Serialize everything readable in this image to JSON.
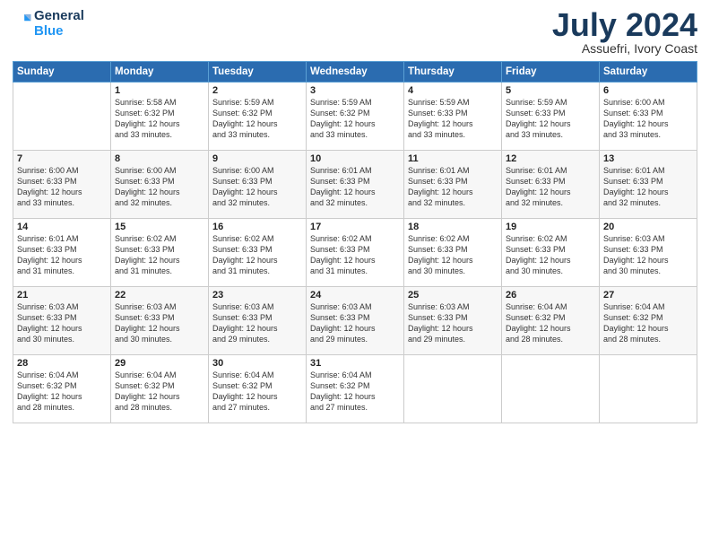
{
  "header": {
    "logo_line1": "General",
    "logo_line2": "Blue",
    "month_title": "July 2024",
    "subtitle": "Assuefri, Ivory Coast"
  },
  "days_of_week": [
    "Sunday",
    "Monday",
    "Tuesday",
    "Wednesday",
    "Thursday",
    "Friday",
    "Saturday"
  ],
  "weeks": [
    [
      {
        "day": "",
        "info": ""
      },
      {
        "day": "1",
        "info": "Sunrise: 5:58 AM\nSunset: 6:32 PM\nDaylight: 12 hours\nand 33 minutes."
      },
      {
        "day": "2",
        "info": "Sunrise: 5:59 AM\nSunset: 6:32 PM\nDaylight: 12 hours\nand 33 minutes."
      },
      {
        "day": "3",
        "info": "Sunrise: 5:59 AM\nSunset: 6:32 PM\nDaylight: 12 hours\nand 33 minutes."
      },
      {
        "day": "4",
        "info": "Sunrise: 5:59 AM\nSunset: 6:33 PM\nDaylight: 12 hours\nand 33 minutes."
      },
      {
        "day": "5",
        "info": "Sunrise: 5:59 AM\nSunset: 6:33 PM\nDaylight: 12 hours\nand 33 minutes."
      },
      {
        "day": "6",
        "info": "Sunrise: 6:00 AM\nSunset: 6:33 PM\nDaylight: 12 hours\nand 33 minutes."
      }
    ],
    [
      {
        "day": "7",
        "info": ""
      },
      {
        "day": "8",
        "info": "Sunrise: 6:00 AM\nSunset: 6:33 PM\nDaylight: 12 hours\nand 32 minutes."
      },
      {
        "day": "9",
        "info": "Sunrise: 6:00 AM\nSunset: 6:33 PM\nDaylight: 12 hours\nand 32 minutes."
      },
      {
        "day": "10",
        "info": "Sunrise: 6:01 AM\nSunset: 6:33 PM\nDaylight: 12 hours\nand 32 minutes."
      },
      {
        "day": "11",
        "info": "Sunrise: 6:01 AM\nSunset: 6:33 PM\nDaylight: 12 hours\nand 32 minutes."
      },
      {
        "day": "12",
        "info": "Sunrise: 6:01 AM\nSunset: 6:33 PM\nDaylight: 12 hours\nand 32 minutes."
      },
      {
        "day": "13",
        "info": "Sunrise: 6:01 AM\nSunset: 6:33 PM\nDaylight: 12 hours\nand 32 minutes."
      }
    ],
    [
      {
        "day": "14",
        "info": ""
      },
      {
        "day": "15",
        "info": "Sunrise: 6:02 AM\nSunset: 6:33 PM\nDaylight: 12 hours\nand 31 minutes."
      },
      {
        "day": "16",
        "info": "Sunrise: 6:02 AM\nSunset: 6:33 PM\nDaylight: 12 hours\nand 31 minutes."
      },
      {
        "day": "17",
        "info": "Sunrise: 6:02 AM\nSunset: 6:33 PM\nDaylight: 12 hours\nand 31 minutes."
      },
      {
        "day": "18",
        "info": "Sunrise: 6:02 AM\nSunset: 6:33 PM\nDaylight: 12 hours\nand 30 minutes."
      },
      {
        "day": "19",
        "info": "Sunrise: 6:02 AM\nSunset: 6:33 PM\nDaylight: 12 hours\nand 30 minutes."
      },
      {
        "day": "20",
        "info": "Sunrise: 6:03 AM\nSunset: 6:33 PM\nDaylight: 12 hours\nand 30 minutes."
      }
    ],
    [
      {
        "day": "21",
        "info": ""
      },
      {
        "day": "22",
        "info": "Sunrise: 6:03 AM\nSunset: 6:33 PM\nDaylight: 12 hours\nand 30 minutes."
      },
      {
        "day": "23",
        "info": "Sunrise: 6:03 AM\nSunset: 6:33 PM\nDaylight: 12 hours\nand 29 minutes."
      },
      {
        "day": "24",
        "info": "Sunrise: 6:03 AM\nSunset: 6:33 PM\nDaylight: 12 hours\nand 29 minutes."
      },
      {
        "day": "25",
        "info": "Sunrise: 6:03 AM\nSunset: 6:33 PM\nDaylight: 12 hours\nand 29 minutes."
      },
      {
        "day": "26",
        "info": "Sunrise: 6:04 AM\nSunset: 6:32 PM\nDaylight: 12 hours\nand 28 minutes."
      },
      {
        "day": "27",
        "info": "Sunrise: 6:04 AM\nSunset: 6:32 PM\nDaylight: 12 hours\nand 28 minutes."
      }
    ],
    [
      {
        "day": "28",
        "info": "Sunrise: 6:04 AM\nSunset: 6:32 PM\nDaylight: 12 hours\nand 28 minutes."
      },
      {
        "day": "29",
        "info": "Sunrise: 6:04 AM\nSunset: 6:32 PM\nDaylight: 12 hours\nand 28 minutes."
      },
      {
        "day": "30",
        "info": "Sunrise: 6:04 AM\nSunset: 6:32 PM\nDaylight: 12 hours\nand 27 minutes."
      },
      {
        "day": "31",
        "info": "Sunrise: 6:04 AM\nSunset: 6:32 PM\nDaylight: 12 hours\nand 27 minutes."
      },
      {
        "day": "",
        "info": ""
      },
      {
        "day": "",
        "info": ""
      },
      {
        "day": "",
        "info": ""
      }
    ]
  ],
  "week1_sunday_info": "Sunrise: 6:00 AM\nSunset: 6:33 PM\nDaylight: 12 hours\nand 33 minutes.",
  "week2_sunday_info": "Sunrise: 6:00 AM\nSunset: 6:33 PM\nDaylight: 12 hours\nand 33 minutes.",
  "week3_sunday_info": "Sunrise: 6:01 AM\nSunset: 6:33 PM\nDaylight: 12 hours\nand 31 minutes.",
  "week4_sunday_info": "Sunrise: 6:03 AM\nSunset: 6:33 PM\nDaylight: 12 hours\nand 30 minutes."
}
